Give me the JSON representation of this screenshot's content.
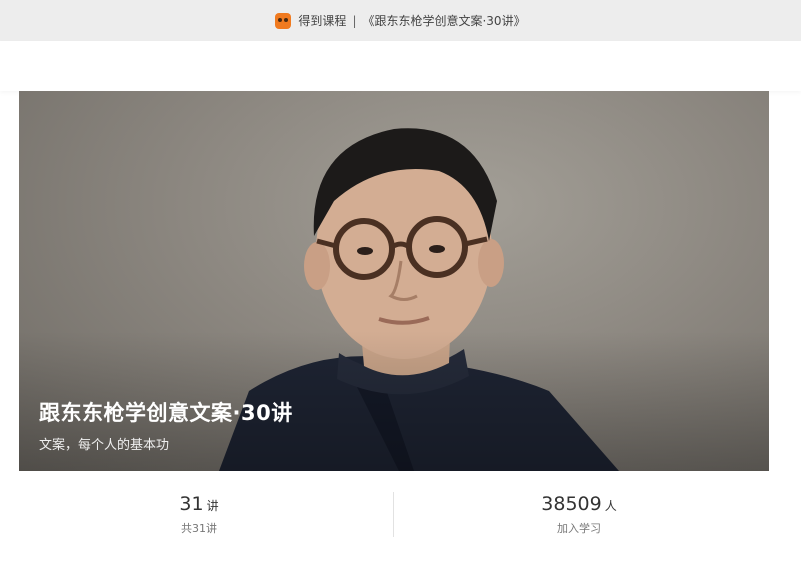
{
  "topbar": {
    "icon": "dedao-app-icon",
    "app_name": "得到课程",
    "separator": "|",
    "course_ref": "《跟东东枪学创意文案·30讲》"
  },
  "hero": {
    "title": "跟东东枪学创意文案·30讲",
    "subtitle": "文案，每个人的基本功"
  },
  "stats": {
    "lectures": {
      "value": "31",
      "unit": "讲",
      "label": "共31讲"
    },
    "learners": {
      "value": "38509",
      "unit": "人",
      "label": "加入学习"
    }
  },
  "colors": {
    "topbar_bg": "#ededed",
    "accent": "#f07a1f",
    "hero_bg": "#8c8780"
  }
}
